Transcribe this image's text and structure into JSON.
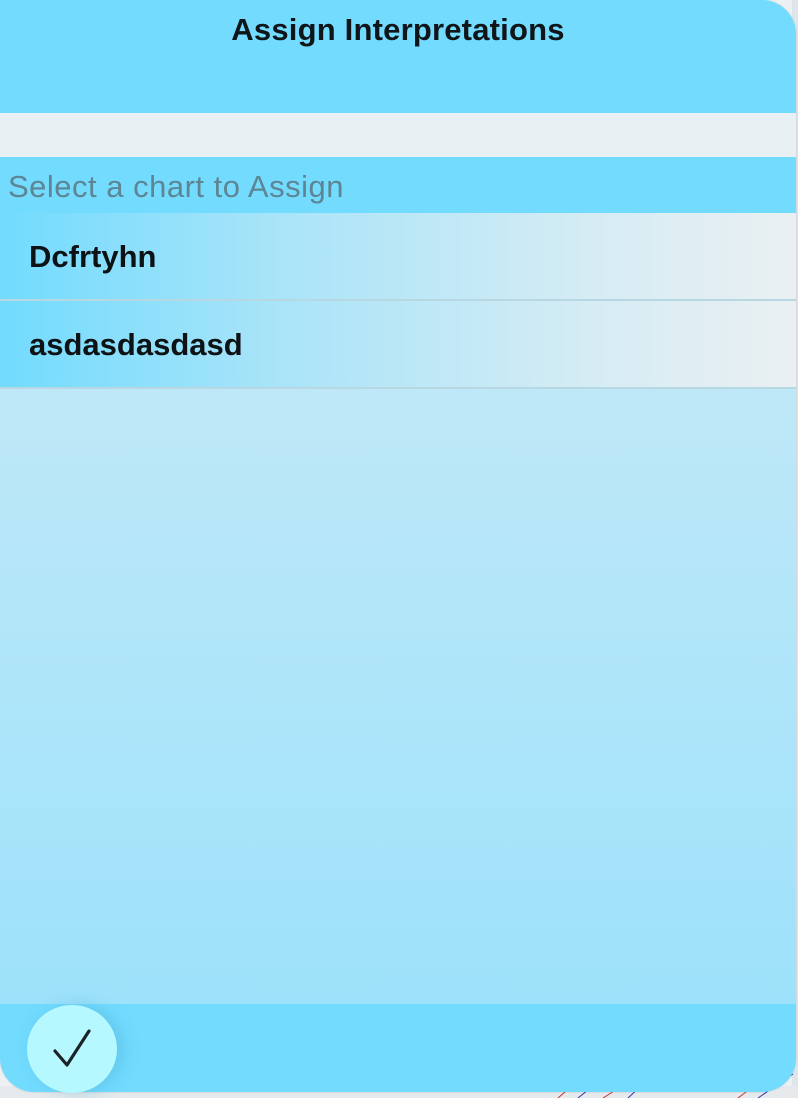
{
  "dialog": {
    "title": "Assign Interpretations",
    "prompt": "Select a chart to Assign"
  },
  "charts": [
    {
      "label": "Dcfrtyhn"
    },
    {
      "label": "asdasdasdasd"
    }
  ],
  "footer": {
    "confirm_icon": "checkmark-icon"
  },
  "colors": {
    "header": "#72dbfe",
    "confirm_button": "#b6f8ff",
    "prompt_text": "#5d8594"
  }
}
